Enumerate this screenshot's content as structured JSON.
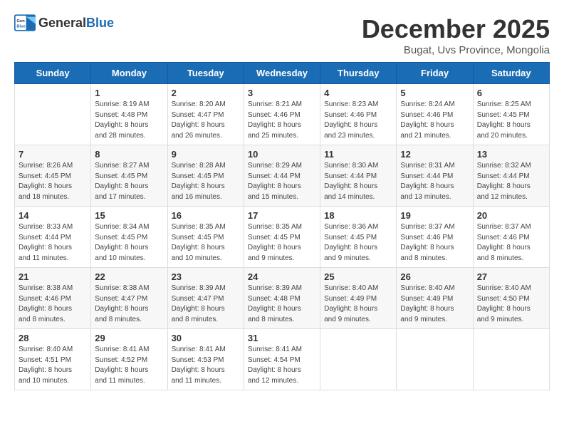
{
  "header": {
    "logo_general": "General",
    "logo_blue": "Blue",
    "month_title": "December 2025",
    "subtitle": "Bugat, Uvs Province, Mongolia"
  },
  "days_of_week": [
    "Sunday",
    "Monday",
    "Tuesday",
    "Wednesday",
    "Thursday",
    "Friday",
    "Saturday"
  ],
  "weeks": [
    [
      {
        "day": "",
        "info": ""
      },
      {
        "day": "1",
        "info": "Sunrise: 8:19 AM\nSunset: 4:48 PM\nDaylight: 8 hours\nand 28 minutes."
      },
      {
        "day": "2",
        "info": "Sunrise: 8:20 AM\nSunset: 4:47 PM\nDaylight: 8 hours\nand 26 minutes."
      },
      {
        "day": "3",
        "info": "Sunrise: 8:21 AM\nSunset: 4:46 PM\nDaylight: 8 hours\nand 25 minutes."
      },
      {
        "day": "4",
        "info": "Sunrise: 8:23 AM\nSunset: 4:46 PM\nDaylight: 8 hours\nand 23 minutes."
      },
      {
        "day": "5",
        "info": "Sunrise: 8:24 AM\nSunset: 4:46 PM\nDaylight: 8 hours\nand 21 minutes."
      },
      {
        "day": "6",
        "info": "Sunrise: 8:25 AM\nSunset: 4:45 PM\nDaylight: 8 hours\nand 20 minutes."
      }
    ],
    [
      {
        "day": "7",
        "info": "Sunrise: 8:26 AM\nSunset: 4:45 PM\nDaylight: 8 hours\nand 18 minutes."
      },
      {
        "day": "8",
        "info": "Sunrise: 8:27 AM\nSunset: 4:45 PM\nDaylight: 8 hours\nand 17 minutes."
      },
      {
        "day": "9",
        "info": "Sunrise: 8:28 AM\nSunset: 4:45 PM\nDaylight: 8 hours\nand 16 minutes."
      },
      {
        "day": "10",
        "info": "Sunrise: 8:29 AM\nSunset: 4:44 PM\nDaylight: 8 hours\nand 15 minutes."
      },
      {
        "day": "11",
        "info": "Sunrise: 8:30 AM\nSunset: 4:44 PM\nDaylight: 8 hours\nand 14 minutes."
      },
      {
        "day": "12",
        "info": "Sunrise: 8:31 AM\nSunset: 4:44 PM\nDaylight: 8 hours\nand 13 minutes."
      },
      {
        "day": "13",
        "info": "Sunrise: 8:32 AM\nSunset: 4:44 PM\nDaylight: 8 hours\nand 12 minutes."
      }
    ],
    [
      {
        "day": "14",
        "info": "Sunrise: 8:33 AM\nSunset: 4:44 PM\nDaylight: 8 hours\nand 11 minutes."
      },
      {
        "day": "15",
        "info": "Sunrise: 8:34 AM\nSunset: 4:45 PM\nDaylight: 8 hours\nand 10 minutes."
      },
      {
        "day": "16",
        "info": "Sunrise: 8:35 AM\nSunset: 4:45 PM\nDaylight: 8 hours\nand 10 minutes."
      },
      {
        "day": "17",
        "info": "Sunrise: 8:35 AM\nSunset: 4:45 PM\nDaylight: 8 hours\nand 9 minutes."
      },
      {
        "day": "18",
        "info": "Sunrise: 8:36 AM\nSunset: 4:45 PM\nDaylight: 8 hours\nand 9 minutes."
      },
      {
        "day": "19",
        "info": "Sunrise: 8:37 AM\nSunset: 4:46 PM\nDaylight: 8 hours\nand 8 minutes."
      },
      {
        "day": "20",
        "info": "Sunrise: 8:37 AM\nSunset: 4:46 PM\nDaylight: 8 hours\nand 8 minutes."
      }
    ],
    [
      {
        "day": "21",
        "info": "Sunrise: 8:38 AM\nSunset: 4:46 PM\nDaylight: 8 hours\nand 8 minutes."
      },
      {
        "day": "22",
        "info": "Sunrise: 8:38 AM\nSunset: 4:47 PM\nDaylight: 8 hours\nand 8 minutes."
      },
      {
        "day": "23",
        "info": "Sunrise: 8:39 AM\nSunset: 4:47 PM\nDaylight: 8 hours\nand 8 minutes."
      },
      {
        "day": "24",
        "info": "Sunrise: 8:39 AM\nSunset: 4:48 PM\nDaylight: 8 hours\nand 8 minutes."
      },
      {
        "day": "25",
        "info": "Sunrise: 8:40 AM\nSunset: 4:49 PM\nDaylight: 8 hours\nand 9 minutes."
      },
      {
        "day": "26",
        "info": "Sunrise: 8:40 AM\nSunset: 4:49 PM\nDaylight: 8 hours\nand 9 minutes."
      },
      {
        "day": "27",
        "info": "Sunrise: 8:40 AM\nSunset: 4:50 PM\nDaylight: 8 hours\nand 9 minutes."
      }
    ],
    [
      {
        "day": "28",
        "info": "Sunrise: 8:40 AM\nSunset: 4:51 PM\nDaylight: 8 hours\nand 10 minutes."
      },
      {
        "day": "29",
        "info": "Sunrise: 8:41 AM\nSunset: 4:52 PM\nDaylight: 8 hours\nand 11 minutes."
      },
      {
        "day": "30",
        "info": "Sunrise: 8:41 AM\nSunset: 4:53 PM\nDaylight: 8 hours\nand 11 minutes."
      },
      {
        "day": "31",
        "info": "Sunrise: 8:41 AM\nSunset: 4:54 PM\nDaylight: 8 hours\nand 12 minutes."
      },
      {
        "day": "",
        "info": ""
      },
      {
        "day": "",
        "info": ""
      },
      {
        "day": "",
        "info": ""
      }
    ]
  ]
}
